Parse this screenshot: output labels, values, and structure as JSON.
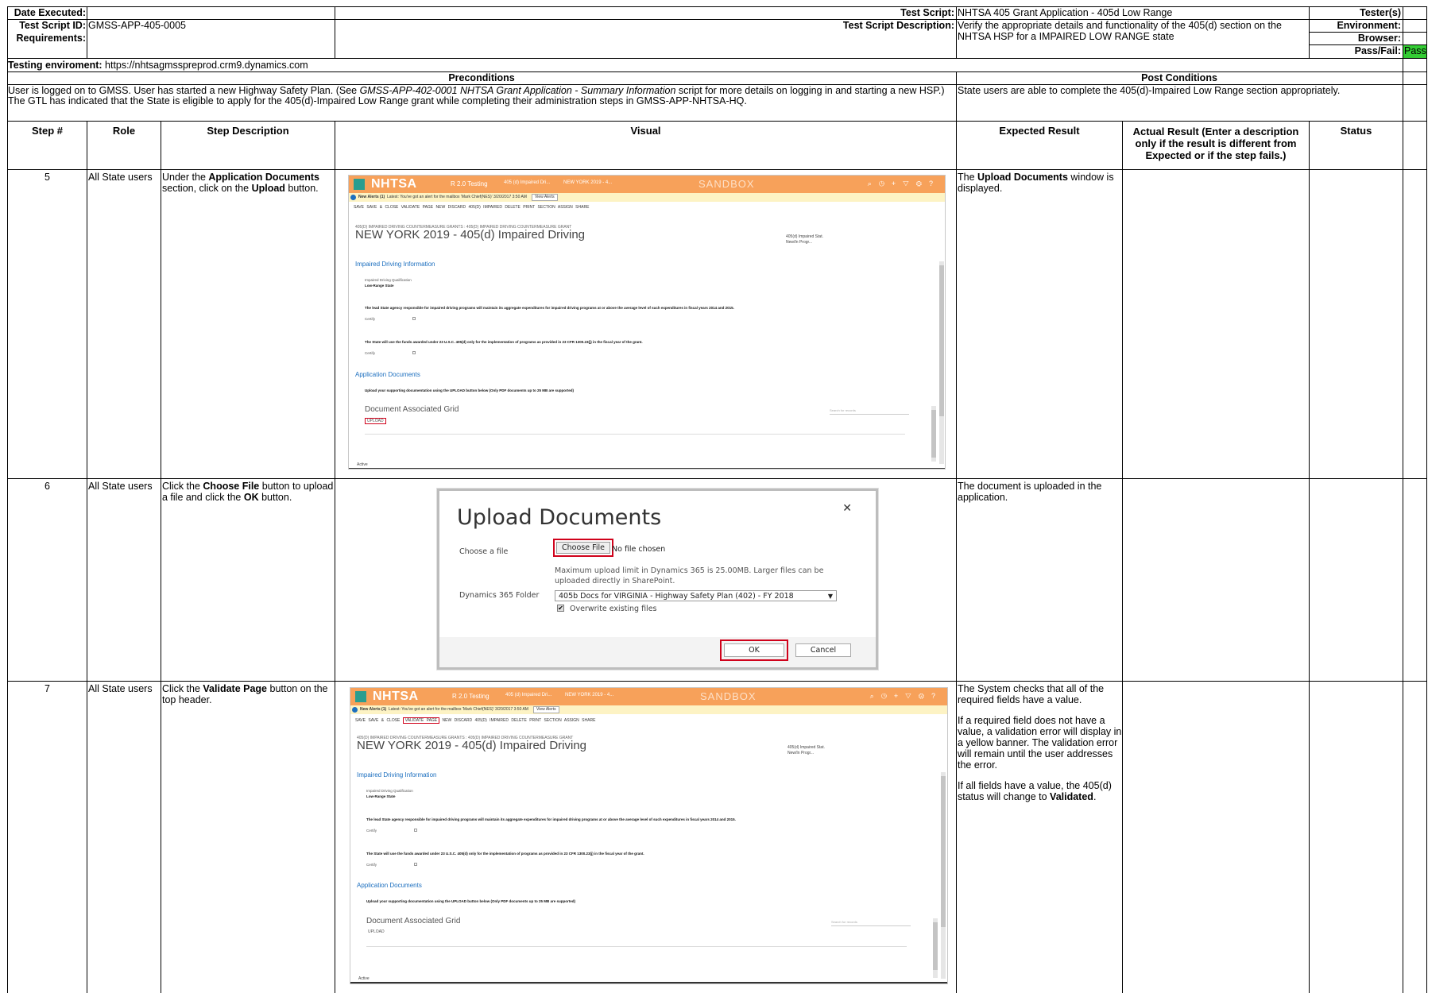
{
  "header": {
    "date_executed_label": "Date Executed:",
    "date_executed_value": "",
    "test_script_id_label": "Test Script ID:",
    "test_script_id_value": "GMSS-APP-405-0005",
    "requirements_label": "Requirements:",
    "requirements_value": "",
    "test_script_label": "Test Script:",
    "test_script_value": "NHTSA 405 Grant Application - 405d Low Range",
    "test_script_description_label": "Test Script Description:",
    "test_script_description_value": "Verify the appropriate details and functionality of the 405(d) section on the NHTSA HSP for a IMPAIRED LOW RANGE state",
    "testers_label": "Tester(s)",
    "environment_label": "Environment:",
    "browser_label": "Browser:",
    "pass_fail_label": "Pass/Fail:",
    "pass_fail_value": "Pass",
    "testing_environment_label": "Testing enviroment:",
    "testing_environment_value": "https://nhtsagmsspreprod.crm9.dynamics.com"
  },
  "conditions": {
    "preconditions_title": "Preconditions",
    "post_conditions_title": "Post Conditions",
    "precondition_line1_a": "User is logged on to GMSS. User has started a new Highway Safety Plan.  (See ",
    "precondition_line1_italic": "GMSS-APP-402-0001 NHTSA Grant Application - Summary Information",
    "precondition_line1_b": " script for more details on logging in and starting a new HSP.)",
    "precondition_line2": "The GTL has indicated that the State is eligible to apply for the 405(d)-Impaired Low Range grant while completing their administration steps in GMSS-APP-NHTSA-HQ.",
    "post_condition_text": "State users are able to complete the 405(d)-Impaired Low Range section appropriately."
  },
  "columns": {
    "step": "Step #",
    "role": "Role",
    "step_description": "Step Description",
    "visual": "Visual",
    "expected_result": "Expected Result",
    "actual_result": "Actual Result (Enter a description only if the result is different from Expected or if the step fails.)",
    "status": "Status"
  },
  "steps": [
    {
      "step": "5",
      "role": "All State users",
      "desc_a": "Under the ",
      "desc_b1": "Application Documents",
      "desc_c": " section, click on the ",
      "desc_b2": "Upload",
      "desc_d": " button.",
      "exp_a": "The ",
      "exp_b": "Upload Documents",
      "exp_c": " window is displayed."
    },
    {
      "step": "6",
      "role": "All State users",
      "desc_a": "Click the ",
      "desc_b1": "Choose File",
      "desc_c": " button to upload a file and click the ",
      "desc_b2": "OK",
      "desc_d": " button.",
      "exp_text": "The document is uploaded in the application."
    },
    {
      "step": "7",
      "role": "All State users",
      "desc_a": "Click the ",
      "desc_b1": "Validate Page",
      "desc_c": " button on the top header.",
      "exp_p1": "The System checks that all of the required fields have a value.",
      "exp_p2": "If a required field does not have a value, a validation error will display in a yellow banner.  The validation error will remain until the user addresses the error.",
      "exp_p3_a": "If all fields have a value, the 405(d) status will change to ",
      "exp_p3_b": "Validated",
      "exp_p3_c": "."
    }
  ],
  "screenshot": {
    "logo": "NHTSA",
    "nav_r20": "R 2.0 Testing",
    "nav_405": "405 (d) Impaired Dri...",
    "nav_ny": "NEW YORK 2019 - 4...",
    "sandbox": "SANDBOX",
    "alert_label": "New Alerts (1)",
    "alert_text": "Latest: You've got an alert for the mailbox 'Mark Chief(NES)' 3/20/2017 3:50 AM",
    "view_alerts": "View Alerts",
    "cmd_save": "SAVE",
    "cmd_save_close": "SAVE & CLOSE",
    "cmd_validate": "VALIDATE PAGE",
    "cmd_new": "NEW",
    "cmd_discard": "DISCARD 405(D) IMPAIRED",
    "cmd_delete": "DELETE",
    "cmd_print": "PRINT SECTION",
    "cmd_assign": "ASSIGN",
    "cmd_share": "SHARE",
    "breadcrumb": "405(D) IMPAIRED DRIVING COUNTERMEASURE GRANTS : 405(D) IMPAIRED DRIVING COUNTERMEASURE GRANT",
    "form_title": "NEW YORK 2019 - 405(d) Impaired Driving",
    "side_label": "405(d) Impaired Stat.",
    "side_value": "New/In Progr...",
    "section1": "Impaired Driving Information",
    "qualification_label": "Impaired Driving Qualification",
    "qualification_value": "Low-Range State",
    "statement1": "The lead State agency responsible for impaired driving programs will maintain its aggregate expenditures for impaired driving programs at or above the average level of such expenditures in fiscal years 2014 and 2015.",
    "certify": "Certify",
    "statement2": "The State will use the funds awarded under 23 U.S.C. 405(d) only for the implementation of programs as provided in 23 CFR 1300.23(j) in the fiscal year of the grant.",
    "section2": "Application Documents",
    "upload_note": "Upload your supporting documentation using the UPLOAD button below (Only PDF documents up to 25 MB are supported)",
    "grid_title": "Document Associated Grid",
    "search_placeholder": "Search for records",
    "upload_button": "UPLOAD",
    "status": "Active"
  },
  "dialog": {
    "title": "Upload Documents",
    "choose_label": "Choose a file",
    "choose_button": "Choose File",
    "no_file": "No file chosen",
    "limit_text": "Maximum upload limit in Dynamics 365 is 25.00MB. Larger files can be uploaded directly in SharePoint.",
    "folder_label": "Dynamics 365 Folder",
    "folder_value": "405b Docs for VIRGINIA - Highway Safety Plan (402) - FY 2018",
    "overwrite_label": "Overwrite existing files",
    "ok": "OK",
    "cancel": "Cancel"
  }
}
